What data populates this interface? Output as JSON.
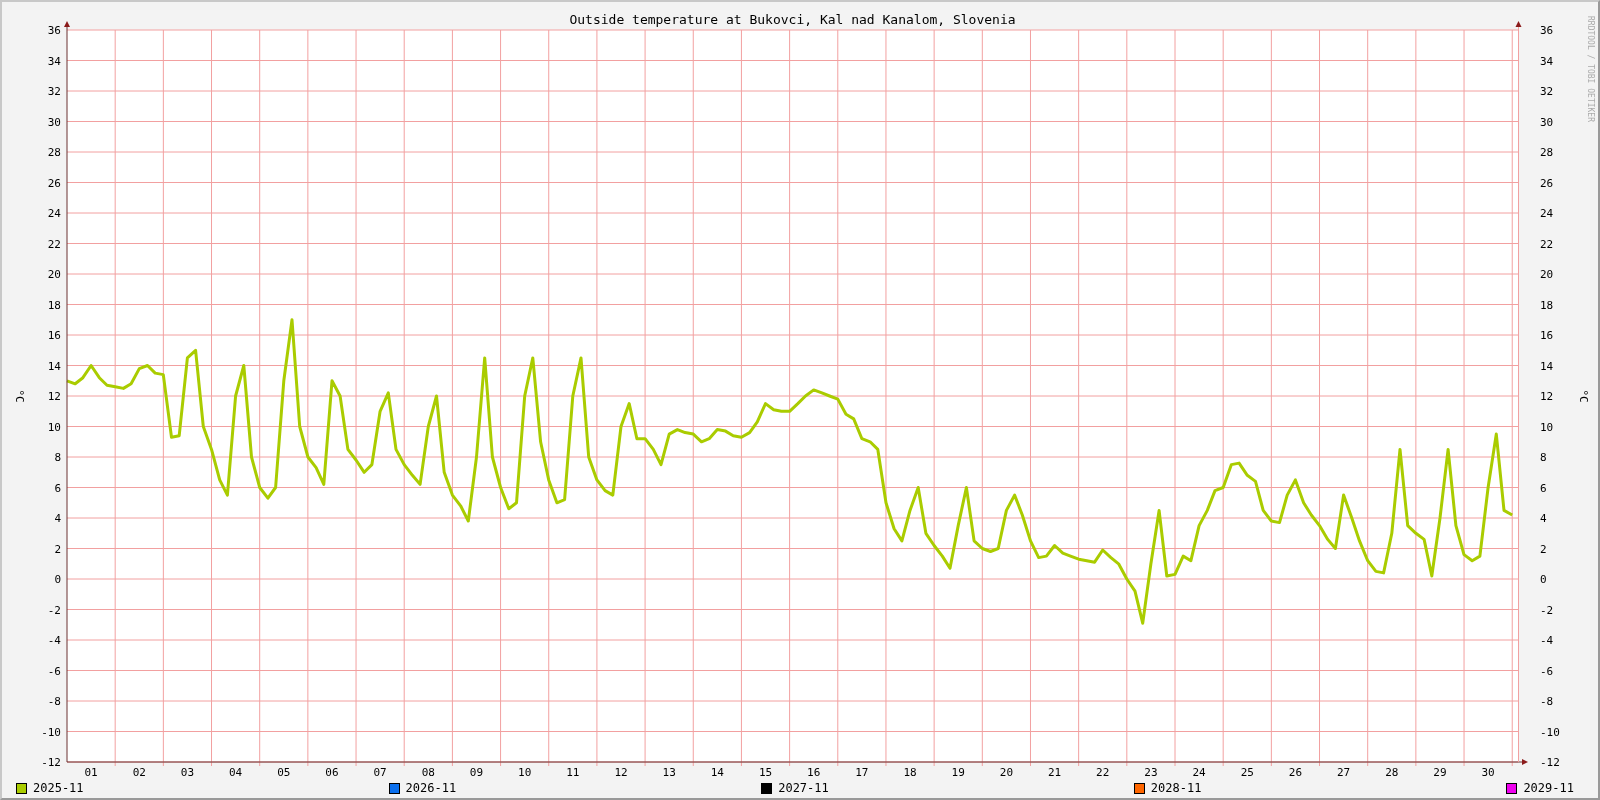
{
  "chart": {
    "chart_data": {
      "type": "line",
      "title": "Outside temperature at Bukovci, Kal nad Kanalom, Slovenia",
      "ylabel": "°C",
      "xlim": [
        0.5,
        30.62
      ],
      "ylim": [
        -12,
        36
      ],
      "grid": true,
      "xticks": [
        {
          "value": 1,
          "label": "01"
        },
        {
          "value": 2,
          "label": "02"
        },
        {
          "value": 3,
          "label": "03"
        },
        {
          "value": 4,
          "label": "04"
        },
        {
          "value": 5,
          "label": "05"
        },
        {
          "value": 6,
          "label": "06"
        },
        {
          "value": 7,
          "label": "07"
        },
        {
          "value": 8,
          "label": "08"
        },
        {
          "value": 9,
          "label": "09"
        },
        {
          "value": 10,
          "label": "10"
        },
        {
          "value": 11,
          "label": "11"
        },
        {
          "value": 12,
          "label": "12"
        },
        {
          "value": 13,
          "label": "13"
        },
        {
          "value": 14,
          "label": "14"
        },
        {
          "value": 15,
          "label": "15"
        },
        {
          "value": 16,
          "label": "16"
        },
        {
          "value": 17,
          "label": "17"
        },
        {
          "value": 18,
          "label": "18"
        },
        {
          "value": 19,
          "label": "19"
        },
        {
          "value": 20,
          "label": "20"
        },
        {
          "value": 21,
          "label": "21"
        },
        {
          "value": 22,
          "label": "22"
        },
        {
          "value": 23,
          "label": "23"
        },
        {
          "value": 24,
          "label": "24"
        },
        {
          "value": 25,
          "label": "25"
        },
        {
          "value": 26,
          "label": "26"
        },
        {
          "value": 27,
          "label": "27"
        },
        {
          "value": 28,
          "label": "28"
        },
        {
          "value": 29,
          "label": "29"
        },
        {
          "value": 30,
          "label": "30"
        }
      ],
      "yticks": [
        {
          "value": 36,
          "label": "36"
        },
        {
          "value": 34,
          "label": "34"
        },
        {
          "value": 32,
          "label": "32"
        },
        {
          "value": 30,
          "label": "30"
        },
        {
          "value": 28,
          "label": "28"
        },
        {
          "value": 26,
          "label": "26"
        },
        {
          "value": 24,
          "label": "24"
        },
        {
          "value": 22,
          "label": "22"
        },
        {
          "value": 20,
          "label": "20"
        },
        {
          "value": 18,
          "label": "18"
        },
        {
          "value": 16,
          "label": "16"
        },
        {
          "value": 14,
          "label": "14"
        },
        {
          "value": 12,
          "label": "12"
        },
        {
          "value": 10,
          "label": "10"
        },
        {
          "value": 8,
          "label": "8"
        },
        {
          "value": 6,
          "label": "6"
        },
        {
          "value": 4,
          "label": "4"
        },
        {
          "value": 2,
          "label": "2"
        },
        {
          "value": 0,
          "label": "0"
        },
        {
          "value": -2,
          "label": "-2"
        },
        {
          "value": -4,
          "label": "-4"
        },
        {
          "value": -6,
          "label": "-6"
        },
        {
          "value": -8,
          "label": "-8"
        },
        {
          "value": -10,
          "label": "-10"
        },
        {
          "value": -12,
          "label": "-12"
        }
      ],
      "x": [
        0.5,
        0.67,
        0.83,
        1,
        1.17,
        1.33,
        1.5,
        1.67,
        1.83,
        2,
        2.17,
        2.33,
        2.5,
        2.67,
        2.83,
        3,
        3.17,
        3.33,
        3.5,
        3.67,
        3.83,
        4,
        4.17,
        4.33,
        4.5,
        4.67,
        4.83,
        5,
        5.17,
        5.33,
        5.5,
        5.67,
        5.83,
        6,
        6.17,
        6.33,
        6.5,
        6.67,
        6.83,
        7,
        7.17,
        7.33,
        7.5,
        7.67,
        7.83,
        8,
        8.17,
        8.33,
        8.5,
        8.67,
        8.83,
        9,
        9.17,
        9.33,
        9.5,
        9.67,
        9.83,
        10,
        10.17,
        10.33,
        10.5,
        10.67,
        10.83,
        11,
        11.17,
        11.33,
        11.5,
        11.67,
        11.83,
        12,
        12.17,
        12.33,
        12.5,
        12.67,
        12.83,
        13,
        13.17,
        13.33,
        13.5,
        13.67,
        13.83,
        14,
        14.17,
        14.33,
        14.5,
        14.67,
        14.83,
        15,
        15.17,
        15.33,
        15.5,
        15.67,
        15.83,
        16,
        16.17,
        16.33,
        16.5,
        16.67,
        16.83,
        17,
        17.17,
        17.33,
        17.5,
        17.67,
        17.83,
        18,
        18.17,
        18.33,
        18.5,
        18.67,
        18.83,
        19,
        19.17,
        19.33,
        19.5,
        19.67,
        19.83,
        20,
        20.17,
        20.33,
        20.5,
        20.67,
        20.83,
        21,
        21.17,
        21.33,
        21.5,
        21.67,
        21.83,
        22,
        22.17,
        22.33,
        22.5,
        22.67,
        22.83,
        23,
        23.17,
        23.33,
        23.5,
        23.67,
        23.83,
        24,
        24.17,
        24.33,
        24.5,
        24.67,
        24.83,
        25,
        25.17,
        25.33,
        25.5,
        25.67,
        25.83,
        26,
        26.17,
        26.33,
        26.5,
        26.67,
        26.83,
        27,
        27.17,
        27.33,
        27.5,
        27.67,
        27.83,
        28,
        28.17,
        28.33,
        28.5,
        28.67,
        28.83,
        29,
        29.17,
        29.33,
        29.5,
        29.67,
        29.83,
        30,
        30.17,
        30.33,
        30.5
      ],
      "series": [
        {
          "color": "#aacc00",
          "values": [
            13,
            12.8,
            13.2,
            14,
            13.2,
            12.7,
            12.6,
            12.5,
            12.8,
            13.8,
            14,
            13.5,
            13.4,
            9.3,
            9.4,
            14.5,
            15,
            10,
            8.5,
            6.5,
            5.5,
            12,
            14,
            8,
            6,
            5.3,
            6,
            13,
            17,
            10,
            8,
            7.3,
            6.2,
            13,
            12,
            8.5,
            7.8,
            7,
            7.5,
            11,
            12.2,
            8.5,
            7.5,
            6.8,
            6.2,
            10,
            12,
            7,
            5.5,
            4.8,
            3.8,
            8,
            14.5,
            8,
            6,
            4.6,
            5,
            12,
            14.5,
            9,
            6.5,
            5,
            5.2,
            12,
            14.5,
            8,
            6.5,
            5.8,
            5.5,
            10,
            11.5,
            9.2,
            9.2,
            8.5,
            7.5,
            9.5,
            9.8,
            9.6,
            9.5,
            9,
            9.2,
            9.8,
            9.7,
            9.4,
            9.3,
            9.6,
            10.3,
            11.5,
            11.1,
            11,
            11,
            11.5,
            12,
            12.4,
            12.2,
            12,
            11.8,
            10.8,
            10.5,
            9.2,
            9,
            8.5,
            5,
            3.3,
            2.5,
            4.5,
            6,
            3,
            2.2,
            1.5,
            0.7,
            3.5,
            6,
            2.5,
            2,
            1.8,
            2,
            4.5,
            5.5,
            4.2,
            2.5,
            1.4,
            1.5,
            2.2,
            1.7,
            1.5,
            1.3,
            1.2,
            1.1,
            1.9,
            1.4,
            1,
            0,
            -0.8,
            -2.9,
            1,
            4.5,
            0.2,
            0.3,
            1.5,
            1.2,
            3.5,
            4.5,
            5.8,
            6,
            7.5,
            7.6,
            6.8,
            6.4,
            4.5,
            3.8,
            3.7,
            5.5,
            6.5,
            5,
            4.2,
            3.5,
            2.6,
            2,
            5.5,
            4,
            2.5,
            1.2,
            0.5,
            0.4,
            3,
            8.5,
            3.5,
            3,
            2.6,
            0.2,
            4,
            8.5,
            3.5,
            1.6,
            1.2,
            1.5,
            6,
            9.5,
            4.5,
            4.2
          ]
        }
      ]
    },
    "right_axis": {
      "label": "°C",
      "ticks": [
        "36",
        "34",
        "32",
        "30",
        "28",
        "26",
        "24",
        "22",
        "20",
        "18",
        "16",
        "14",
        "12",
        "10",
        "8",
        "6",
        "4",
        "2",
        "0",
        "-2",
        "-4",
        "-6",
        "-8",
        "-10",
        "-12"
      ]
    },
    "credit": "RRDTOOL / TOBI OETIKER"
  },
  "legend": [
    {
      "name": "2025-11",
      "color": "#aacc00"
    },
    {
      "name": "2026-11",
      "color": "#0a6fee"
    },
    {
      "name": "2027-11",
      "color": "#000000"
    },
    {
      "name": "2028-11",
      "color": "#ff6600"
    },
    {
      "name": "2029-11",
      "color": "#ee00ee"
    }
  ]
}
